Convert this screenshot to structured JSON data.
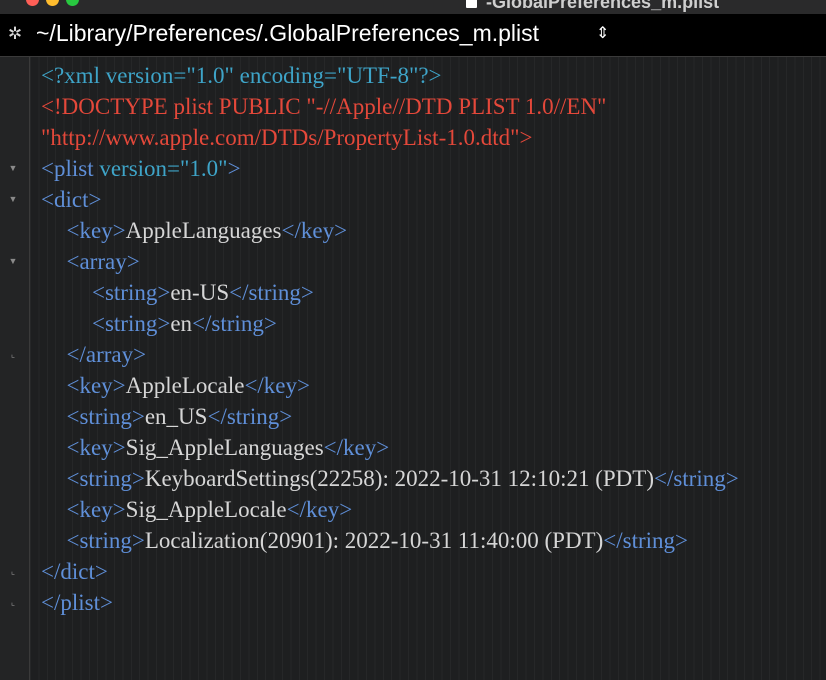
{
  "window": {
    "title": "-GlobalPreferences_m.plist"
  },
  "path_bar": {
    "path": "~/Library/Preferences/.GlobalPreferences_m.plist",
    "gear_icon": "gear-icon",
    "chevron_icon": "up-down-chevron-icon"
  },
  "colors": {
    "background": "#1e1f20",
    "xml_decl": "#3ea4c8",
    "doctype": "#e4483a",
    "tag": "#5f8fd8",
    "text": "#d6d6d6"
  },
  "gutter": {
    "folds": [
      {
        "line": 4,
        "icon": "fold-open-triangle-icon"
      },
      {
        "line": 5,
        "icon": "fold-open-triangle-icon"
      },
      {
        "line": 7,
        "icon": "fold-open-triangle-icon"
      },
      {
        "line": 10,
        "icon": "fold-end-icon"
      },
      {
        "line": 17,
        "icon": "fold-end-icon"
      },
      {
        "line": 18,
        "icon": "fold-end-icon"
      }
    ]
  },
  "code": {
    "lines": [
      {
        "indent": 0,
        "tokens": [
          {
            "t": "decl",
            "v": "<?xml version=\"1.0\" encoding=\"UTF-8\"?>"
          }
        ]
      },
      {
        "indent": 0,
        "tokens": [
          {
            "t": "doctype",
            "v": "<!DOCTYPE plist PUBLIC \"-//Apple//DTD PLIST 1.0//EN\""
          }
        ]
      },
      {
        "indent": 0,
        "tokens": [
          {
            "t": "doctype",
            "v": "\"http://www.apple.com/DTDs/PropertyList-1.0.dtd\">"
          }
        ]
      },
      {
        "indent": 0,
        "tokens": [
          {
            "t": "tag",
            "v": "<plist "
          },
          {
            "t": "decl",
            "v": "version=\"1.0\""
          },
          {
            "t": "tag",
            "v": ">"
          }
        ]
      },
      {
        "indent": 0,
        "tokens": [
          {
            "t": "tag",
            "v": "<dict>"
          }
        ]
      },
      {
        "indent": 1,
        "tokens": [
          {
            "t": "tag",
            "v": "<key>"
          },
          {
            "t": "text",
            "v": "AppleLanguages"
          },
          {
            "t": "tag",
            "v": "</key>"
          }
        ]
      },
      {
        "indent": 1,
        "tokens": [
          {
            "t": "tag",
            "v": "<array>"
          }
        ]
      },
      {
        "indent": 2,
        "tokens": [
          {
            "t": "tag",
            "v": "<string>"
          },
          {
            "t": "text",
            "v": "en-US"
          },
          {
            "t": "tag",
            "v": "</string>"
          }
        ]
      },
      {
        "indent": 2,
        "tokens": [
          {
            "t": "tag",
            "v": "<string>"
          },
          {
            "t": "text",
            "v": "en"
          },
          {
            "t": "tag",
            "v": "</string>"
          }
        ]
      },
      {
        "indent": 1,
        "tokens": [
          {
            "t": "tag",
            "v": "</array>"
          }
        ]
      },
      {
        "indent": 1,
        "tokens": [
          {
            "t": "tag",
            "v": "<key>"
          },
          {
            "t": "text",
            "v": "AppleLocale"
          },
          {
            "t": "tag",
            "v": "</key>"
          }
        ]
      },
      {
        "indent": 1,
        "tokens": [
          {
            "t": "tag",
            "v": "<string>"
          },
          {
            "t": "text",
            "v": "en_US"
          },
          {
            "t": "tag",
            "v": "</string>"
          }
        ]
      },
      {
        "indent": 1,
        "tokens": [
          {
            "t": "tag",
            "v": "<key>"
          },
          {
            "t": "text",
            "v": "Sig_AppleLanguages"
          },
          {
            "t": "tag",
            "v": "</key>"
          }
        ]
      },
      {
        "indent": 1,
        "tokens": [
          {
            "t": "tag",
            "v": "<string>"
          },
          {
            "t": "text",
            "v": "KeyboardSettings(22258): 2022-10-31 12:10:21 (PDT)"
          },
          {
            "t": "tag",
            "v": "</string>"
          }
        ]
      },
      {
        "indent": 1,
        "tokens": [
          {
            "t": "tag",
            "v": "<key>"
          },
          {
            "t": "text",
            "v": "Sig_AppleLocale"
          },
          {
            "t": "tag",
            "v": "</key>"
          }
        ]
      },
      {
        "indent": 1,
        "tokens": [
          {
            "t": "tag",
            "v": "<string>"
          },
          {
            "t": "text",
            "v": "Localization(20901): 2022-10-31 11:40:00 (PDT)"
          },
          {
            "t": "tag",
            "v": "</string>"
          }
        ]
      },
      {
        "indent": 0,
        "tokens": [
          {
            "t": "tag",
            "v": "</dict>"
          }
        ]
      },
      {
        "indent": 0,
        "tokens": [
          {
            "t": "tag",
            "v": "</plist>"
          }
        ]
      }
    ]
  }
}
